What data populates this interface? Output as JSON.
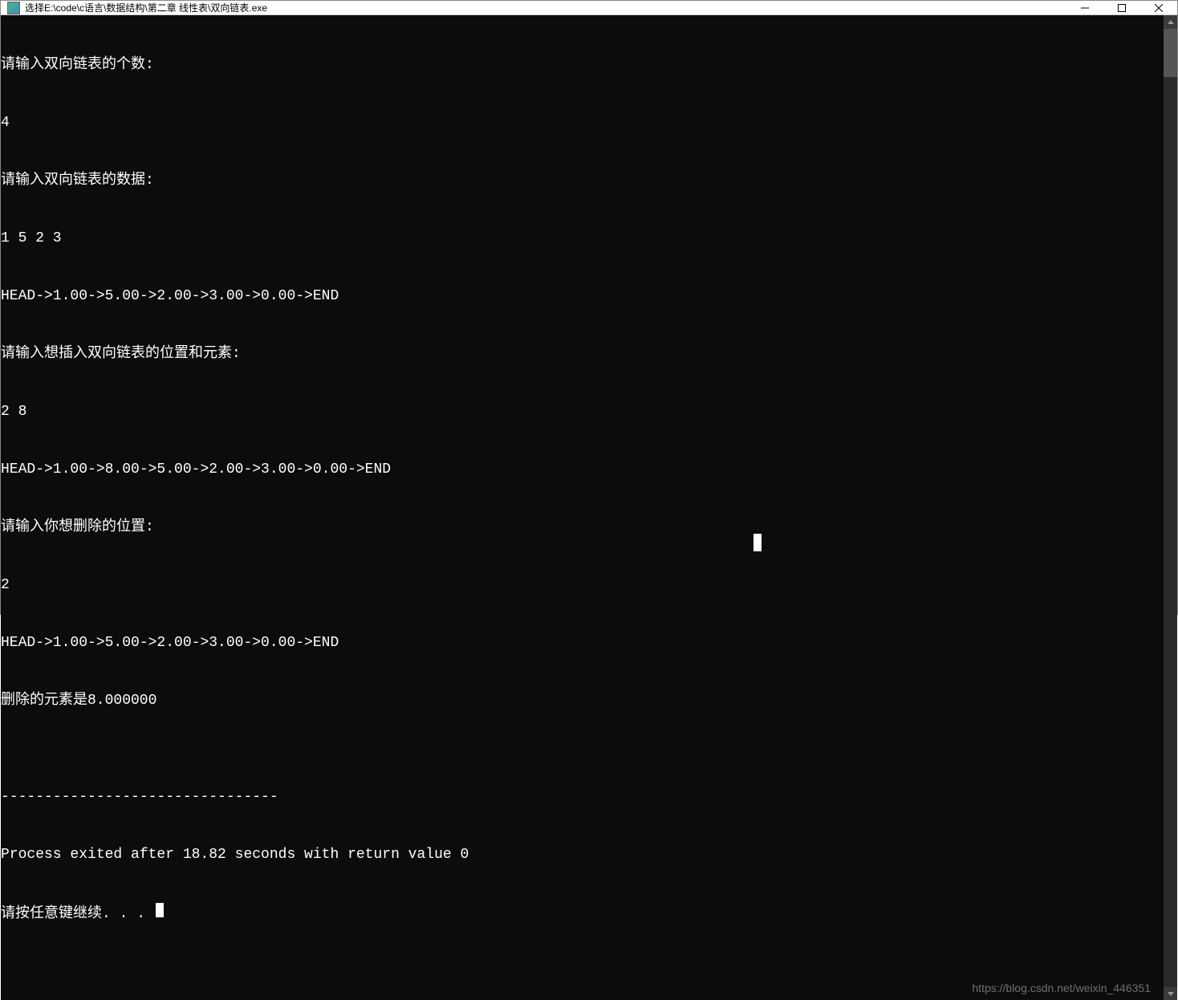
{
  "titlebar": {
    "title": "选择E:\\code\\c语言\\数据结构\\第二章 线性表\\双向链表.exe"
  },
  "console": {
    "lines": [
      "请输入双向链表的个数:",
      "4",
      "请输入双向链表的数据:",
      "1 5 2 3",
      "HEAD->1.00->5.00->2.00->3.00->0.00->END",
      "请输入想插入双向链表的位置和元素:",
      "2 8",
      "HEAD->1.00->8.00->5.00->2.00->3.00->0.00->END",
      "请输入你想删除的位置:",
      "2",
      "HEAD->1.00->5.00->2.00->3.00->0.00->END",
      "删除的元素是8.000000",
      "",
      "--------------------------------",
      "Process exited after 18.82 seconds with return value 0",
      "请按任意键继续. . . "
    ]
  },
  "watermark": "https://blog.csdn.net/weixin_446351"
}
